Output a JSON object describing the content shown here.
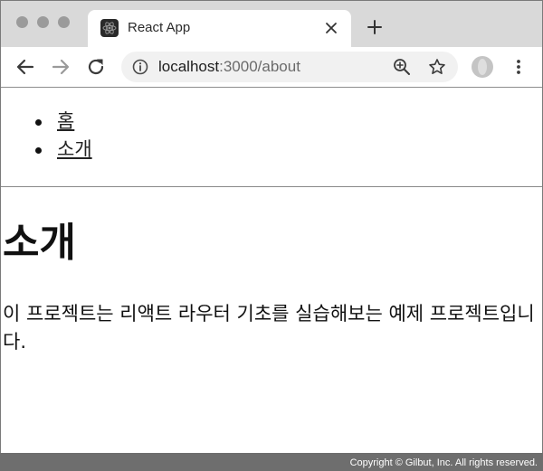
{
  "browser": {
    "tab": {
      "title": "React App",
      "favicon": "react-logo-icon"
    },
    "address_bar": {
      "url_host": "localhost",
      "url_rest": ":3000/about"
    },
    "icons": {
      "back": "arrow-left-icon",
      "forward": "arrow-right-icon",
      "reload": "reload-icon",
      "info": "info-icon",
      "zoom": "zoom-icon",
      "bookmark": "star-icon",
      "profile": "avatar-icon",
      "menu": "kebab-menu-icon",
      "close_tab": "close-icon",
      "new_tab": "plus-icon"
    }
  },
  "page": {
    "nav": [
      {
        "label": "홈"
      },
      {
        "label": "소개"
      }
    ],
    "title": "소개",
    "description": "이 프로젝트는 리액트 라우터 기초를 실습해보는 예제 프로젝트입니다."
  },
  "footer": {
    "copyright": "Copyright © Gilbut, Inc. All rights reserved."
  },
  "colors": {
    "tab_strip": "#d9d9d9",
    "omnibox": "#f1f1f1",
    "footer": "#6e6e6e"
  }
}
